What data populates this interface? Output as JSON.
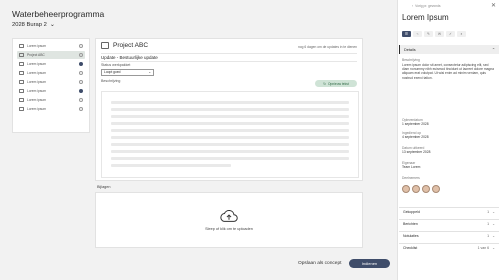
{
  "header": {
    "title": "Waterbeheerprogramma",
    "subtitle": "2028 Burap 2",
    "subtitle_icon": "chevron-down-icon"
  },
  "left_list": {
    "items": [
      {
        "label": "Lorem ipsum",
        "status": "empty",
        "selected": false
      },
      {
        "label": "Project ABC",
        "status": "empty",
        "selected": true
      },
      {
        "label": "Lorem ipsum",
        "status": "filled",
        "selected": false
      },
      {
        "label": "Lorem ipsum",
        "status": "empty",
        "selected": false
      },
      {
        "label": "Lorem ipsum",
        "status": "empty",
        "selected": false
      },
      {
        "label": "Lorem ipsum",
        "status": "filled",
        "selected": false
      },
      {
        "label": "Lorem ipsum",
        "status": "empty",
        "selected": false
      },
      {
        "label": "Lorem ipsum",
        "status": "empty",
        "selected": false
      }
    ]
  },
  "main": {
    "title": "Project ABC",
    "note": "nog 6 dagen om de updates in te dienen",
    "update_title": "Update - Bestuurlijke update",
    "status_label": "Status werkpakket",
    "status_value": "Loopt goed",
    "beschrijving_label": "Beschrijving",
    "save_label": "Opnieuw tekst"
  },
  "bijlagen": {
    "label": "Bijlagen",
    "upload_text": "Sleep of klik om te uploaden"
  },
  "footer": {
    "concept_label": "Opslaan als concept",
    "submit_label": "Indienen"
  },
  "panel": {
    "breadcrumb": "Vorig pr. gevonds",
    "title": "Lorem Ipsum",
    "details_label": "Details",
    "beschrijving_label": "Beschrijving",
    "beschrijving_text": "Lorem ipsum dolor sit amet, consectetur adipiscing elit, sed diam nonummy nibh euismod tincidunt ut laoreet dolore magna aliquam erat volutpat. Ut wisi enim ad minim veniam, quis nostrud exerci tation.",
    "opleverdatum_label": "Opleverdatum",
    "opleverdatum_value": "1 september 2028",
    "ingediend_label": "Ingediend op",
    "ingediend_value": "4 september 2028",
    "datum_label": "Datum uitkeerd",
    "datum_value": "13 september 2028",
    "eigenaar_label": "Eigenaar",
    "eigenaar_value": "Team Lorem",
    "deelnemers_label": "Deelnemers",
    "sections": [
      {
        "label": "Gekoppeld",
        "count": "1"
      },
      {
        "label": "Berichten",
        "count": "1"
      },
      {
        "label": "Notulaties",
        "count": "1"
      },
      {
        "label": "Checklist",
        "count": "1 van 6"
      }
    ]
  },
  "colors": {
    "accent": "#3f4d6a",
    "save_bg": "#cfe3d6"
  }
}
